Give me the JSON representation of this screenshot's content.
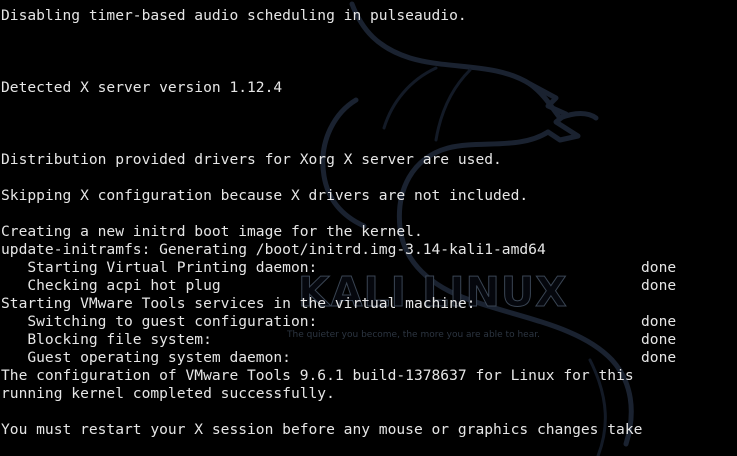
{
  "watermark": {
    "title": "KALI LINUX",
    "tagline": "The quieter you become, the more you are able to hear."
  },
  "lines": [
    {
      "text": "Disabling timer-based audio scheduling in pulseaudio.",
      "status": ""
    },
    {
      "text": "",
      "status": ""
    },
    {
      "text": "",
      "status": ""
    },
    {
      "text": "",
      "status": ""
    },
    {
      "text": "Detected X server version 1.12.4",
      "status": ""
    },
    {
      "text": "",
      "status": ""
    },
    {
      "text": "",
      "status": ""
    },
    {
      "text": "",
      "status": ""
    },
    {
      "text": "Distribution provided drivers for Xorg X server are used.",
      "status": ""
    },
    {
      "text": "",
      "status": ""
    },
    {
      "text": "Skipping X configuration because X drivers are not included.",
      "status": ""
    },
    {
      "text": "",
      "status": ""
    },
    {
      "text": "Creating a new initrd boot image for the kernel.",
      "status": ""
    },
    {
      "text": "update-initramfs: Generating /boot/initrd.img-3.14-kali1-amd64",
      "status": ""
    },
    {
      "text": "   Starting Virtual Printing daemon:",
      "status": "done"
    },
    {
      "text": "   Checking acpi hot plug",
      "status": "done"
    },
    {
      "text": "Starting VMware Tools services in the virtual machine:",
      "status": ""
    },
    {
      "text": "   Switching to guest configuration:",
      "status": "done"
    },
    {
      "text": "   Blocking file system:",
      "status": "done"
    },
    {
      "text": "   Guest operating system daemon:",
      "status": "done"
    },
    {
      "text": "The configuration of VMware Tools 9.6.1 build-1378637 for Linux for this",
      "status": ""
    },
    {
      "text": "running kernel completed successfully.",
      "status": ""
    },
    {
      "text": "",
      "status": ""
    },
    {
      "text": "You must restart your X session before any mouse or graphics changes take",
      "status": ""
    }
  ]
}
